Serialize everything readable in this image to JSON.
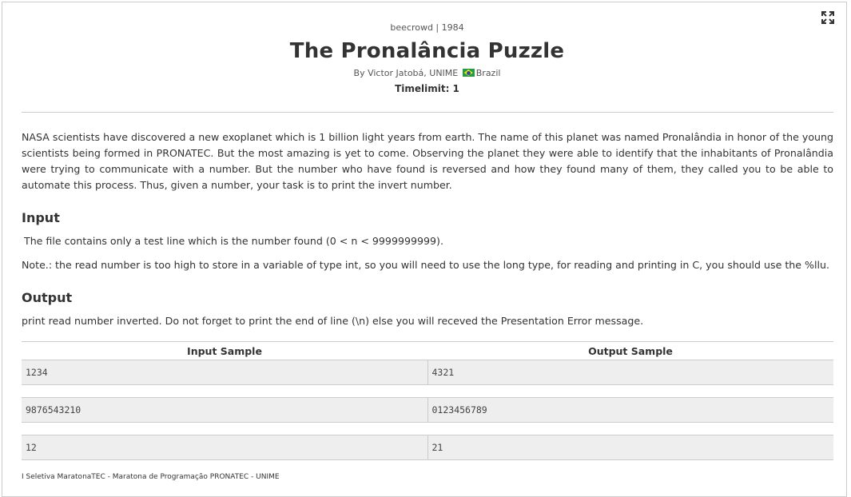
{
  "problem": {
    "source": "beecrowd | 1984",
    "title": "The Pronalância Puzzle",
    "author_prefix": "By Victor Jatobá, UNIME",
    "country": "Brazil",
    "timelimit": "Timelimit: 1",
    "description": "NASA scientists have discovered a new exoplanet which is 1 billion light years from earth. The name of this planet was named Pronalândia in honor of the young scientists being formed in PRONATEC. But the most amazing is yet to come. Observing the planet they were able to identify that the inhabitants of Pronalândia were trying to communicate with a number. But the number who have found is reversed and how they found many of them, they called you to be able to automate this process. Thus, given a number, your task is to print the invert number.",
    "input_title": "Input",
    "input_text": "The file contains only a test line which is the number found (0 < n < 9999999999).",
    "input_note": "Note.: the read number is too high to store in a variable of type int, so you will need to use the long type, for reading and printing in C, you should use the %llu.",
    "output_title": "Output",
    "output_text": "print read number inverted. Do not forget to print the end of line (\\n) else you will receved the Presentation Error message.",
    "samples": {
      "input_header": "Input Sample",
      "output_header": "Output Sample",
      "rows": [
        {
          "input": "1234",
          "output": "4321"
        },
        {
          "input": "9876543210",
          "output": "0123456789"
        },
        {
          "input": "12",
          "output": "21"
        }
      ]
    },
    "footer": "I Seletiva MaratonaTEC - Maratona de Programação PRONATEC - UNIME"
  },
  "icons": {
    "expand": "expand-fullscreen-icon",
    "flag": "brazil-flag-icon"
  }
}
